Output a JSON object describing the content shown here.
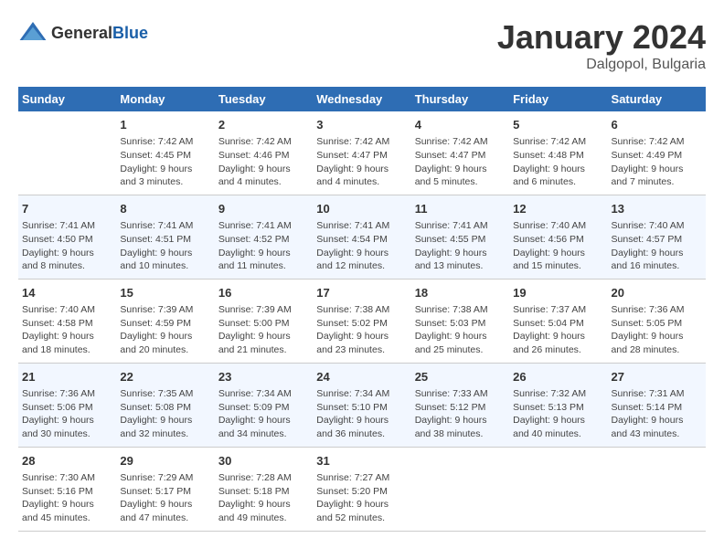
{
  "logo": {
    "general": "General",
    "blue": "Blue"
  },
  "title": "January 2024",
  "subtitle": "Dalgopol, Bulgaria",
  "days_of_week": [
    "Sunday",
    "Monday",
    "Tuesday",
    "Wednesday",
    "Thursday",
    "Friday",
    "Saturday"
  ],
  "weeks": [
    [
      {
        "num": "",
        "info": ""
      },
      {
        "num": "1",
        "info": "Sunrise: 7:42 AM\nSunset: 4:45 PM\nDaylight: 9 hours\nand 3 minutes."
      },
      {
        "num": "2",
        "info": "Sunrise: 7:42 AM\nSunset: 4:46 PM\nDaylight: 9 hours\nand 4 minutes."
      },
      {
        "num": "3",
        "info": "Sunrise: 7:42 AM\nSunset: 4:47 PM\nDaylight: 9 hours\nand 4 minutes."
      },
      {
        "num": "4",
        "info": "Sunrise: 7:42 AM\nSunset: 4:47 PM\nDaylight: 9 hours\nand 5 minutes."
      },
      {
        "num": "5",
        "info": "Sunrise: 7:42 AM\nSunset: 4:48 PM\nDaylight: 9 hours\nand 6 minutes."
      },
      {
        "num": "6",
        "info": "Sunrise: 7:42 AM\nSunset: 4:49 PM\nDaylight: 9 hours\nand 7 minutes."
      }
    ],
    [
      {
        "num": "7",
        "info": "Sunrise: 7:41 AM\nSunset: 4:50 PM\nDaylight: 9 hours\nand 8 minutes."
      },
      {
        "num": "8",
        "info": "Sunrise: 7:41 AM\nSunset: 4:51 PM\nDaylight: 9 hours\nand 10 minutes."
      },
      {
        "num": "9",
        "info": "Sunrise: 7:41 AM\nSunset: 4:52 PM\nDaylight: 9 hours\nand 11 minutes."
      },
      {
        "num": "10",
        "info": "Sunrise: 7:41 AM\nSunset: 4:54 PM\nDaylight: 9 hours\nand 12 minutes."
      },
      {
        "num": "11",
        "info": "Sunrise: 7:41 AM\nSunset: 4:55 PM\nDaylight: 9 hours\nand 13 minutes."
      },
      {
        "num": "12",
        "info": "Sunrise: 7:40 AM\nSunset: 4:56 PM\nDaylight: 9 hours\nand 15 minutes."
      },
      {
        "num": "13",
        "info": "Sunrise: 7:40 AM\nSunset: 4:57 PM\nDaylight: 9 hours\nand 16 minutes."
      }
    ],
    [
      {
        "num": "14",
        "info": "Sunrise: 7:40 AM\nSunset: 4:58 PM\nDaylight: 9 hours\nand 18 minutes."
      },
      {
        "num": "15",
        "info": "Sunrise: 7:39 AM\nSunset: 4:59 PM\nDaylight: 9 hours\nand 20 minutes."
      },
      {
        "num": "16",
        "info": "Sunrise: 7:39 AM\nSunset: 5:00 PM\nDaylight: 9 hours\nand 21 minutes."
      },
      {
        "num": "17",
        "info": "Sunrise: 7:38 AM\nSunset: 5:02 PM\nDaylight: 9 hours\nand 23 minutes."
      },
      {
        "num": "18",
        "info": "Sunrise: 7:38 AM\nSunset: 5:03 PM\nDaylight: 9 hours\nand 25 minutes."
      },
      {
        "num": "19",
        "info": "Sunrise: 7:37 AM\nSunset: 5:04 PM\nDaylight: 9 hours\nand 26 minutes."
      },
      {
        "num": "20",
        "info": "Sunrise: 7:36 AM\nSunset: 5:05 PM\nDaylight: 9 hours\nand 28 minutes."
      }
    ],
    [
      {
        "num": "21",
        "info": "Sunrise: 7:36 AM\nSunset: 5:06 PM\nDaylight: 9 hours\nand 30 minutes."
      },
      {
        "num": "22",
        "info": "Sunrise: 7:35 AM\nSunset: 5:08 PM\nDaylight: 9 hours\nand 32 minutes."
      },
      {
        "num": "23",
        "info": "Sunrise: 7:34 AM\nSunset: 5:09 PM\nDaylight: 9 hours\nand 34 minutes."
      },
      {
        "num": "24",
        "info": "Sunrise: 7:34 AM\nSunset: 5:10 PM\nDaylight: 9 hours\nand 36 minutes."
      },
      {
        "num": "25",
        "info": "Sunrise: 7:33 AM\nSunset: 5:12 PM\nDaylight: 9 hours\nand 38 minutes."
      },
      {
        "num": "26",
        "info": "Sunrise: 7:32 AM\nSunset: 5:13 PM\nDaylight: 9 hours\nand 40 minutes."
      },
      {
        "num": "27",
        "info": "Sunrise: 7:31 AM\nSunset: 5:14 PM\nDaylight: 9 hours\nand 43 minutes."
      }
    ],
    [
      {
        "num": "28",
        "info": "Sunrise: 7:30 AM\nSunset: 5:16 PM\nDaylight: 9 hours\nand 45 minutes."
      },
      {
        "num": "29",
        "info": "Sunrise: 7:29 AM\nSunset: 5:17 PM\nDaylight: 9 hours\nand 47 minutes."
      },
      {
        "num": "30",
        "info": "Sunrise: 7:28 AM\nSunset: 5:18 PM\nDaylight: 9 hours\nand 49 minutes."
      },
      {
        "num": "31",
        "info": "Sunrise: 7:27 AM\nSunset: 5:20 PM\nDaylight: 9 hours\nand 52 minutes."
      },
      {
        "num": "",
        "info": ""
      },
      {
        "num": "",
        "info": ""
      },
      {
        "num": "",
        "info": ""
      }
    ]
  ]
}
